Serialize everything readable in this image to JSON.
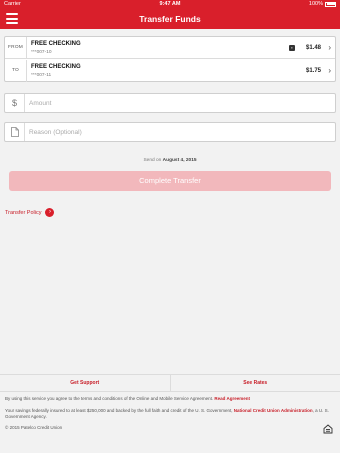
{
  "status_bar": {
    "carrier": "Carrier",
    "time": "9:47 AM",
    "battery": "100%"
  },
  "header": {
    "title": "Transfer Funds",
    "menu_icon": "hamburger-menu-icon"
  },
  "accounts": {
    "from": {
      "tag": "FROM",
      "name": "FREE CHECKING",
      "number": "***007-10",
      "balance": "$1.48",
      "flag_icon": "account-badge-icon"
    },
    "to": {
      "tag": "TO",
      "name": "FREE CHECKING",
      "number": "***007-11",
      "balance": "$1.75"
    }
  },
  "form": {
    "amount_icon": "$",
    "amount_placeholder": "Amount",
    "reason_placeholder": "Reason (Optional)",
    "send_on_label": "Send on",
    "send_on_date": "August 4, 2015",
    "complete_button": "Complete Transfer",
    "transfer_policy": "Transfer Policy"
  },
  "footer": {
    "get_support": "Get Support",
    "see_rates": "See Rates",
    "agreement_text": "By using this service you agree to the terms and conditions of the Online and Mobile Service Agreement.",
    "agreement_link": "Read Agreement",
    "insurance_text_1": "Your savings federally insured to at least $250,000 and backed by the full faith and credit of the U. S. Government,",
    "insurance_link": "National Credit Union Administration",
    "insurance_text_2": ", a U. S. Government Agency.",
    "copyright": "© 2015 Patelco Credit Union",
    "equal_housing_icon": "equal-housing-lender-icon"
  },
  "colors": {
    "brand_red": "#d91f2b",
    "button_disabled": "#f2b8bc",
    "background": "#f2f2f2"
  }
}
